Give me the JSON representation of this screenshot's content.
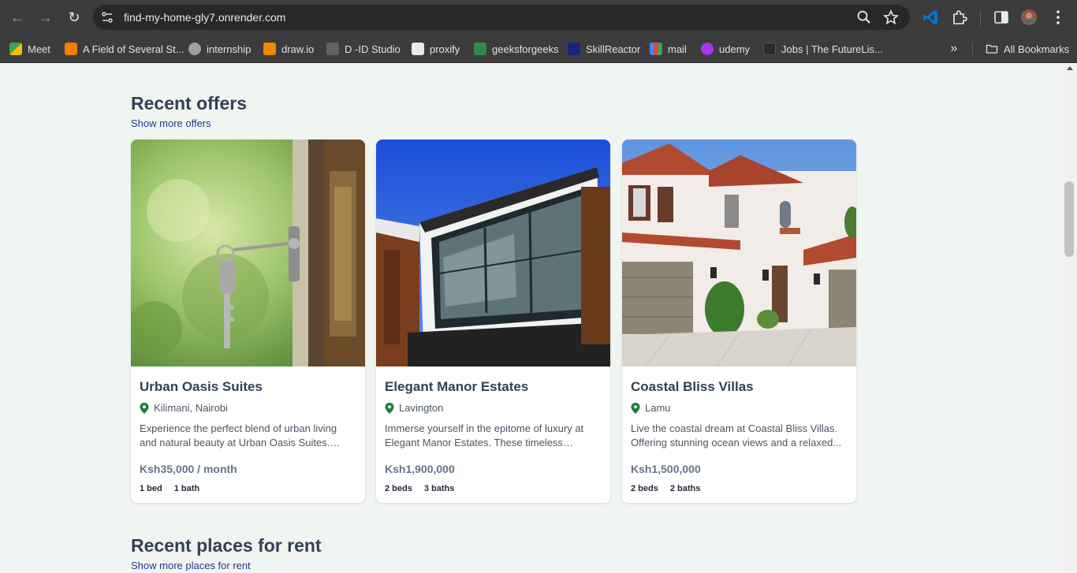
{
  "browser": {
    "url": "find-my-home-gly7.onrender.com",
    "bookmarks": [
      {
        "label": "Meet",
        "color": "#34a853"
      },
      {
        "label": "A Field of Several St...",
        "color": "#f57c00"
      },
      {
        "label": "internship",
        "color": "#9aa0a6"
      },
      {
        "label": "draw.io",
        "color": "#f08705"
      },
      {
        "label": "D -ID Studio",
        "color": "#5f6368"
      },
      {
        "label": "proxify",
        "color": "#e8eaed"
      },
      {
        "label": "geeksforgeeks",
        "color": "#2f8d46"
      },
      {
        "label": "SkillReactor",
        "color": "#1a237e"
      },
      {
        "label": "mail",
        "color": "#ea4335"
      },
      {
        "label": "udemy",
        "color": "#a435f0"
      },
      {
        "label": "Jobs | The FutureLis...",
        "color": "#3c3c3c"
      }
    ],
    "all_bookmarks": "All Bookmarks"
  },
  "offers": {
    "title": "Recent offers",
    "link": "Show more offers",
    "cards": [
      {
        "name": "Urban Oasis Suites",
        "location": "Kilimani, Nairobi",
        "description": "Experience the perfect blend of urban living and natural beauty at Urban Oasis Suites. These...",
        "price": "Ksh35,000 / month",
        "beds": "1 bed",
        "baths": "1 bath",
        "image": "key-in-door-photo"
      },
      {
        "name": "Elegant Manor Estates",
        "location": "Lavington",
        "description": "Immerse yourself in the epitome of luxury at Elegant Manor Estates. These timeless residenc...",
        "price": "Ksh1,900,000",
        "beds": "2 beds",
        "baths": "3 baths",
        "image": "modern-house-photo"
      },
      {
        "name": "Coastal Bliss Villas",
        "location": "Lamu",
        "description": "Live the coastal dream at Coastal Bliss Villas. Offering stunning ocean views and a relaxed...",
        "price": "Ksh1,500,000",
        "beds": "2 beds",
        "baths": "2 baths",
        "image": "white-villa-photo"
      }
    ]
  },
  "rent": {
    "title": "Recent places for rent",
    "link": "Show more places for rent"
  },
  "colors": {
    "page_bg": "#f1f5f1",
    "title": "#334155",
    "link": "#1e3a8a",
    "pin": "#15803d"
  }
}
